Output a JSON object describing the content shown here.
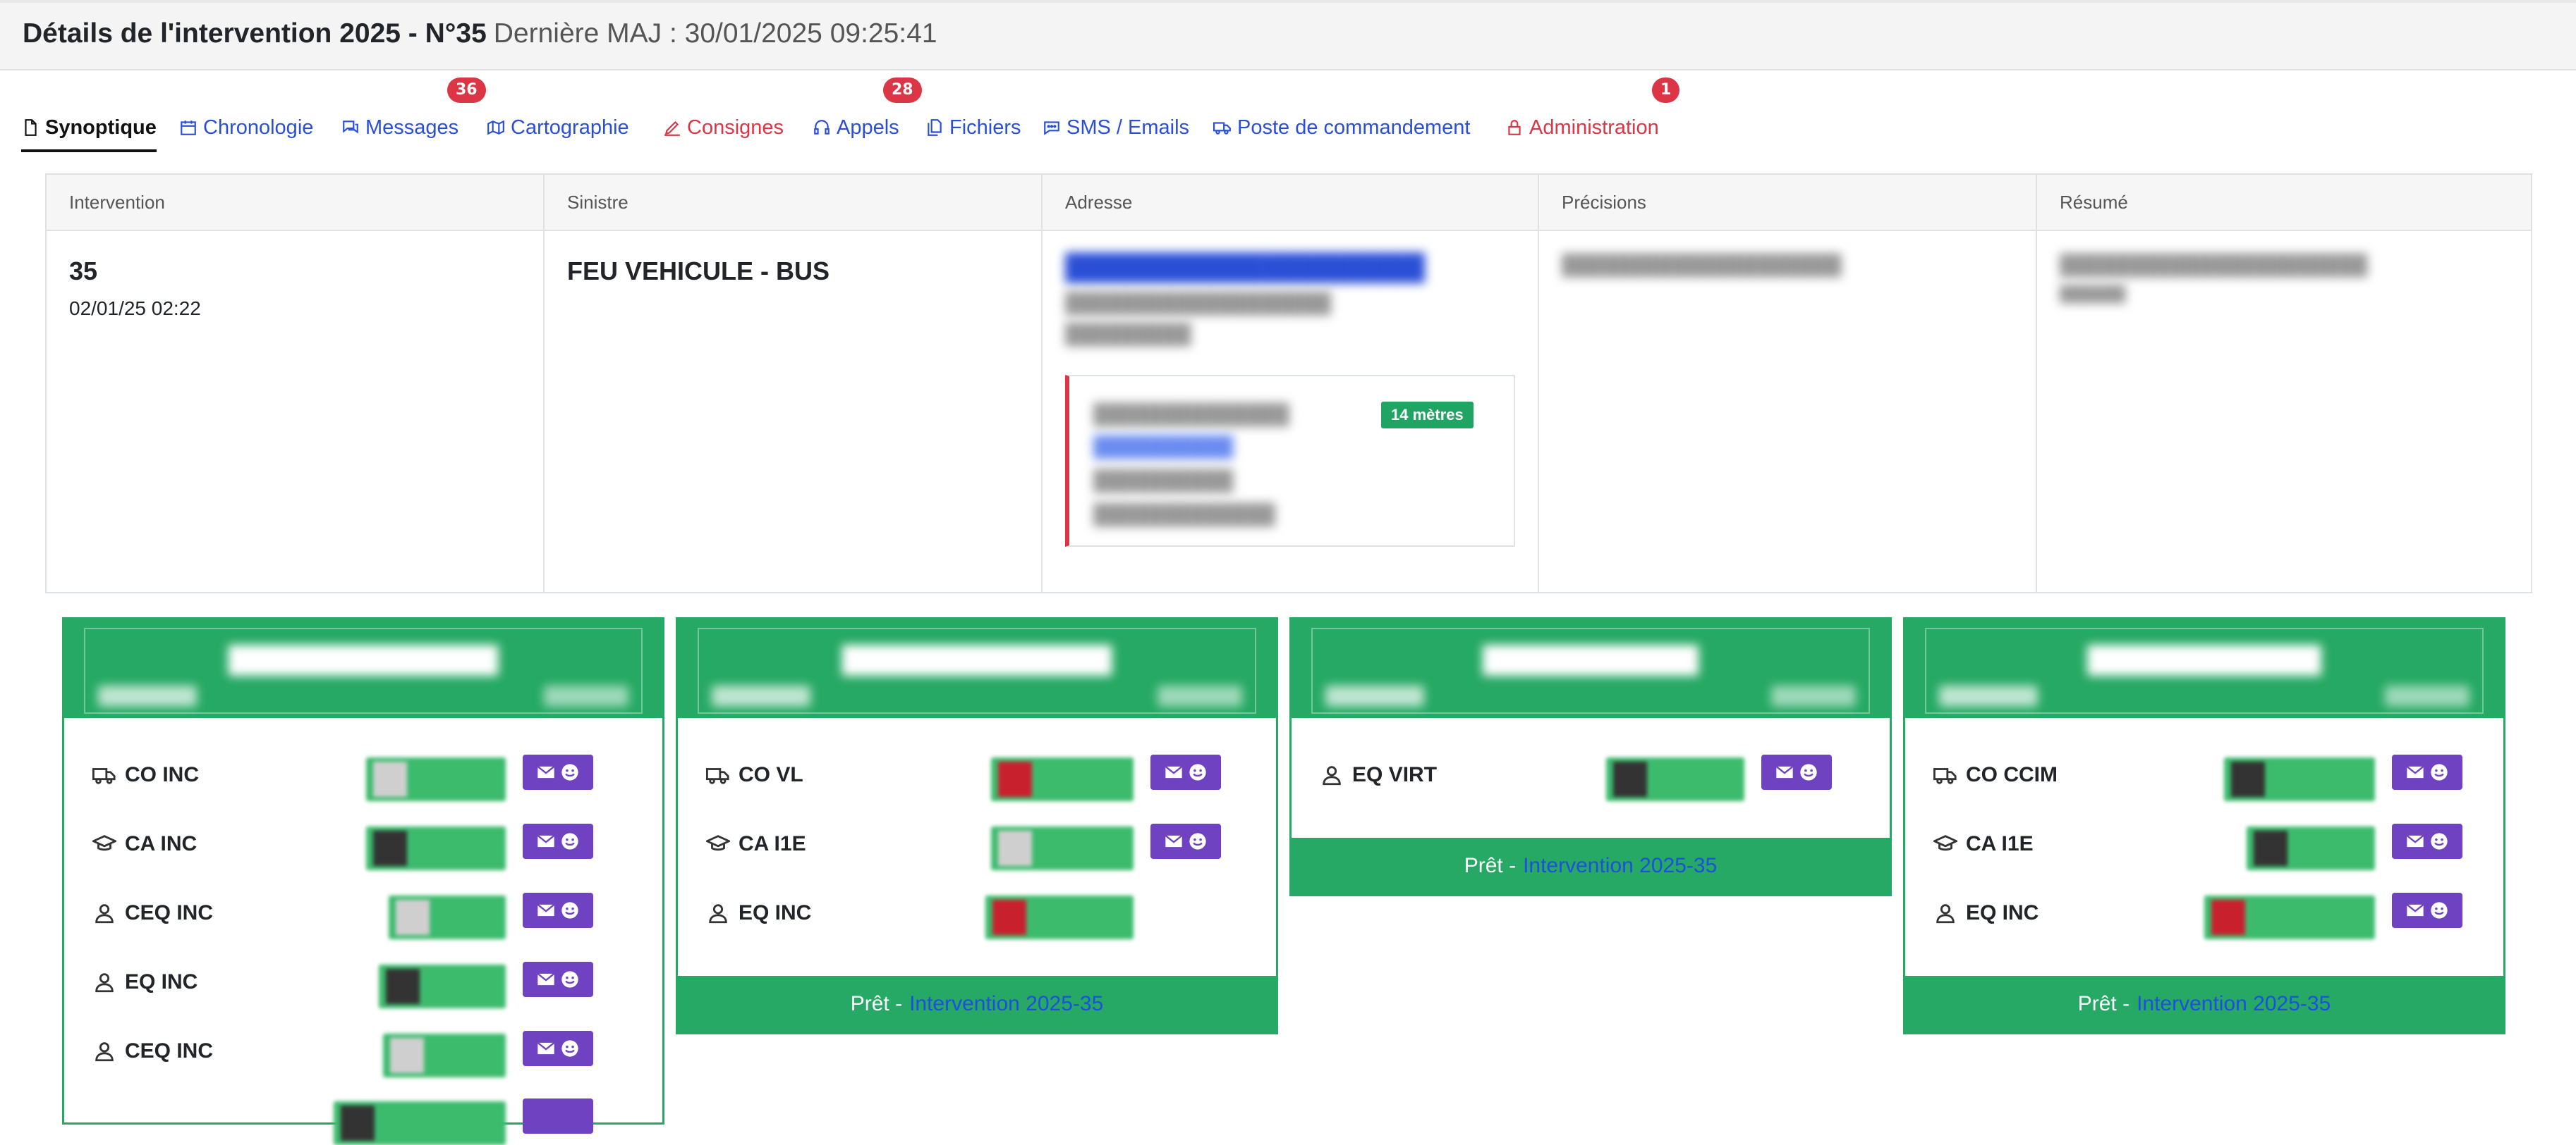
{
  "header": {
    "title": "Détails de l'intervention 2025 - N°35",
    "updated": "Dernière MAJ : 30/01/2025 09:25:41"
  },
  "tabs": [
    {
      "label": "Synoptique",
      "icon": "file-icon",
      "active": true
    },
    {
      "label": "Chronologie",
      "icon": "calendar-icon"
    },
    {
      "label": "Messages",
      "icon": "chat-icon",
      "badge": "36"
    },
    {
      "label": "Cartographie",
      "icon": "map-icon"
    },
    {
      "label": "Consignes",
      "icon": "pen-icon",
      "color": "red"
    },
    {
      "label": "Appels",
      "icon": "headset-icon",
      "badge": "28"
    },
    {
      "label": "Fichiers",
      "icon": "files-icon"
    },
    {
      "label": "SMS / Emails",
      "icon": "sms-icon"
    },
    {
      "label": "Poste de commandement",
      "icon": "truck-icon"
    },
    {
      "label": "Administration",
      "icon": "lock-icon",
      "color": "red",
      "badge": "1"
    }
  ],
  "info": {
    "headers": [
      "Intervention",
      "Sinistre",
      "Adresse",
      "Précisions",
      "Résumé"
    ],
    "intervention_number": "35",
    "intervention_date": "02/01/25 02:22",
    "sinistre": "FEU VEHICULE - BUS",
    "geo_badge": "14 mètres"
  },
  "cards": [
    {
      "rows": [
        {
          "label": "CO INC",
          "icon": "truck-icon"
        },
        {
          "label": "CA INC",
          "icon": "graduation-cap-icon"
        },
        {
          "label": "CEQ INC",
          "icon": "user-icon"
        },
        {
          "label": "EQ INC",
          "icon": "user-icon"
        },
        {
          "label": "CEQ INC",
          "icon": "user-icon"
        }
      ],
      "footer": null
    },
    {
      "rows": [
        {
          "label": "CO VL",
          "icon": "truck-icon"
        },
        {
          "label": "CA I1E",
          "icon": "graduation-cap-icon"
        },
        {
          "label": "EQ INC",
          "icon": "user-icon"
        }
      ],
      "footer": {
        "status": "Prêt -",
        "link": "Intervention 2025-35"
      }
    },
    {
      "rows": [
        {
          "label": "EQ VIRT",
          "icon": "user-icon"
        }
      ],
      "footer": {
        "status": "Prêt -",
        "link": "Intervention 2025-35"
      }
    },
    {
      "rows": [
        {
          "label": "CO CCIM",
          "icon": "truck-icon"
        },
        {
          "label": "CA I1E",
          "icon": "graduation-cap-icon"
        },
        {
          "label": "EQ INC",
          "icon": "user-icon"
        }
      ],
      "footer": {
        "status": "Prêt -",
        "link": "Intervention 2025-35"
      }
    }
  ],
  "colors": {
    "link": "#2a4fd6",
    "danger": "#dc3545",
    "success": "#26a964",
    "action": "#6f42c1"
  }
}
